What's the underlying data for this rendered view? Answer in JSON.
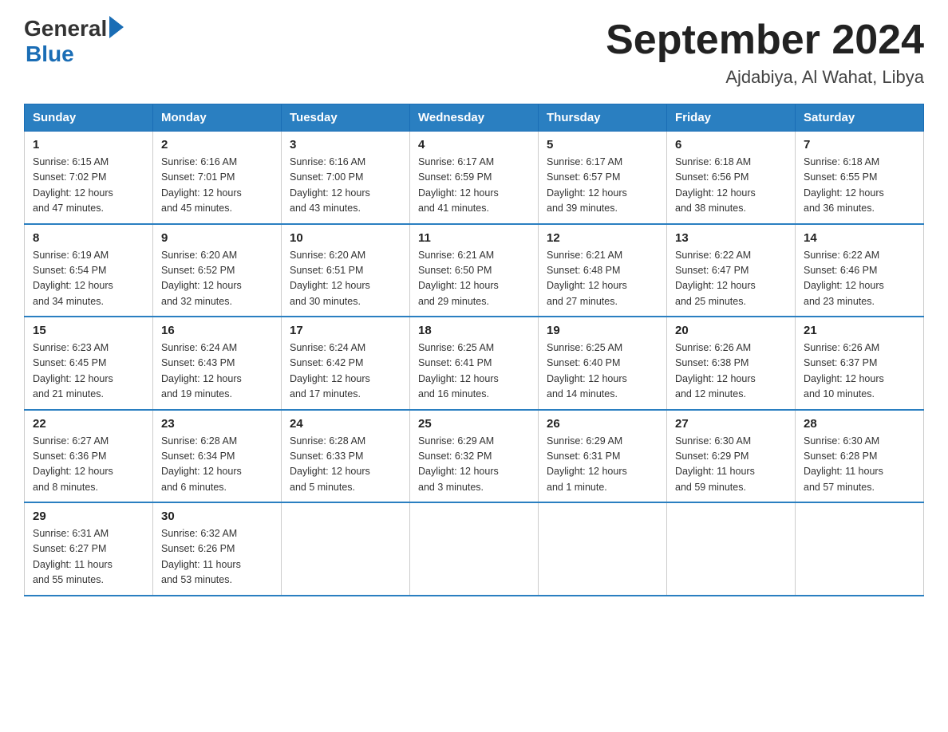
{
  "header": {
    "logo_general": "General",
    "logo_blue": "Blue",
    "title": "September 2024",
    "location": "Ajdabiya, Al Wahat, Libya"
  },
  "days_of_week": [
    "Sunday",
    "Monday",
    "Tuesday",
    "Wednesday",
    "Thursday",
    "Friday",
    "Saturday"
  ],
  "weeks": [
    [
      {
        "day": "1",
        "sunrise": "6:15 AM",
        "sunset": "7:02 PM",
        "daylight": "12 hours and 47 minutes."
      },
      {
        "day": "2",
        "sunrise": "6:16 AM",
        "sunset": "7:01 PM",
        "daylight": "12 hours and 45 minutes."
      },
      {
        "day": "3",
        "sunrise": "6:16 AM",
        "sunset": "7:00 PM",
        "daylight": "12 hours and 43 minutes."
      },
      {
        "day": "4",
        "sunrise": "6:17 AM",
        "sunset": "6:59 PM",
        "daylight": "12 hours and 41 minutes."
      },
      {
        "day": "5",
        "sunrise": "6:17 AM",
        "sunset": "6:57 PM",
        "daylight": "12 hours and 39 minutes."
      },
      {
        "day": "6",
        "sunrise": "6:18 AM",
        "sunset": "6:56 PM",
        "daylight": "12 hours and 38 minutes."
      },
      {
        "day": "7",
        "sunrise": "6:18 AM",
        "sunset": "6:55 PM",
        "daylight": "12 hours and 36 minutes."
      }
    ],
    [
      {
        "day": "8",
        "sunrise": "6:19 AM",
        "sunset": "6:54 PM",
        "daylight": "12 hours and 34 minutes."
      },
      {
        "day": "9",
        "sunrise": "6:20 AM",
        "sunset": "6:52 PM",
        "daylight": "12 hours and 32 minutes."
      },
      {
        "day": "10",
        "sunrise": "6:20 AM",
        "sunset": "6:51 PM",
        "daylight": "12 hours and 30 minutes."
      },
      {
        "day": "11",
        "sunrise": "6:21 AM",
        "sunset": "6:50 PM",
        "daylight": "12 hours and 29 minutes."
      },
      {
        "day": "12",
        "sunrise": "6:21 AM",
        "sunset": "6:48 PM",
        "daylight": "12 hours and 27 minutes."
      },
      {
        "day": "13",
        "sunrise": "6:22 AM",
        "sunset": "6:47 PM",
        "daylight": "12 hours and 25 minutes."
      },
      {
        "day": "14",
        "sunrise": "6:22 AM",
        "sunset": "6:46 PM",
        "daylight": "12 hours and 23 minutes."
      }
    ],
    [
      {
        "day": "15",
        "sunrise": "6:23 AM",
        "sunset": "6:45 PM",
        "daylight": "12 hours and 21 minutes."
      },
      {
        "day": "16",
        "sunrise": "6:24 AM",
        "sunset": "6:43 PM",
        "daylight": "12 hours and 19 minutes."
      },
      {
        "day": "17",
        "sunrise": "6:24 AM",
        "sunset": "6:42 PM",
        "daylight": "12 hours and 17 minutes."
      },
      {
        "day": "18",
        "sunrise": "6:25 AM",
        "sunset": "6:41 PM",
        "daylight": "12 hours and 16 minutes."
      },
      {
        "day": "19",
        "sunrise": "6:25 AM",
        "sunset": "6:40 PM",
        "daylight": "12 hours and 14 minutes."
      },
      {
        "day": "20",
        "sunrise": "6:26 AM",
        "sunset": "6:38 PM",
        "daylight": "12 hours and 12 minutes."
      },
      {
        "day": "21",
        "sunrise": "6:26 AM",
        "sunset": "6:37 PM",
        "daylight": "12 hours and 10 minutes."
      }
    ],
    [
      {
        "day": "22",
        "sunrise": "6:27 AM",
        "sunset": "6:36 PM",
        "daylight": "12 hours and 8 minutes."
      },
      {
        "day": "23",
        "sunrise": "6:28 AM",
        "sunset": "6:34 PM",
        "daylight": "12 hours and 6 minutes."
      },
      {
        "day": "24",
        "sunrise": "6:28 AM",
        "sunset": "6:33 PM",
        "daylight": "12 hours and 5 minutes."
      },
      {
        "day": "25",
        "sunrise": "6:29 AM",
        "sunset": "6:32 PM",
        "daylight": "12 hours and 3 minutes."
      },
      {
        "day": "26",
        "sunrise": "6:29 AM",
        "sunset": "6:31 PM",
        "daylight": "12 hours and 1 minute."
      },
      {
        "day": "27",
        "sunrise": "6:30 AM",
        "sunset": "6:29 PM",
        "daylight": "11 hours and 59 minutes."
      },
      {
        "day": "28",
        "sunrise": "6:30 AM",
        "sunset": "6:28 PM",
        "daylight": "11 hours and 57 minutes."
      }
    ],
    [
      {
        "day": "29",
        "sunrise": "6:31 AM",
        "sunset": "6:27 PM",
        "daylight": "11 hours and 55 minutes."
      },
      {
        "day": "30",
        "sunrise": "6:32 AM",
        "sunset": "6:26 PM",
        "daylight": "11 hours and 53 minutes."
      },
      null,
      null,
      null,
      null,
      null
    ]
  ],
  "labels": {
    "sunrise": "Sunrise:",
    "sunset": "Sunset:",
    "daylight": "Daylight:"
  }
}
